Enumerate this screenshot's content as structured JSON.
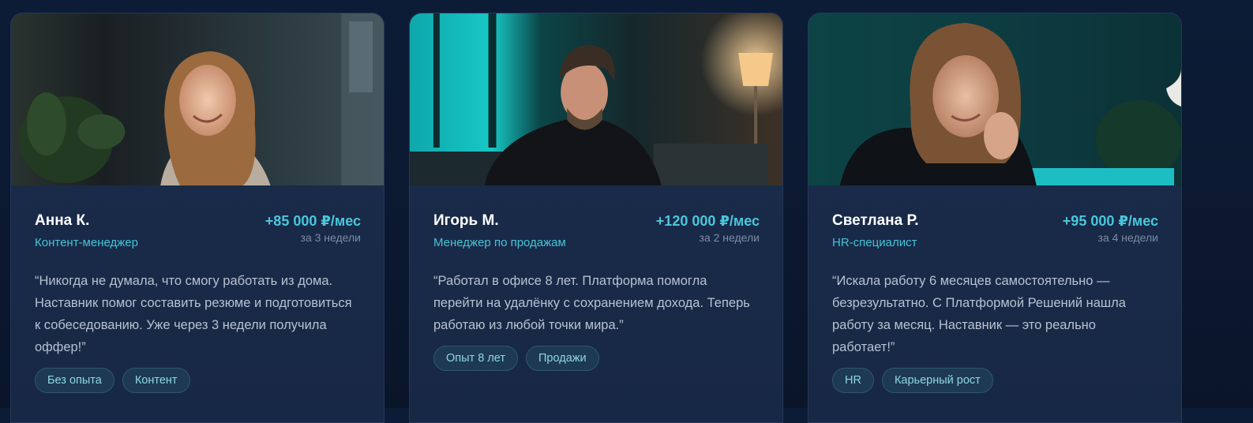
{
  "testimonials": [
    {
      "name": "Анна К.",
      "role": "Контент-менеджер",
      "income": "+85 000 ₽/мес",
      "period": "за 3 недели",
      "quote": "“Никогда не думала, что смогу работать из дома. Наставник помог составить резюме и подготовиться к собеседованию. Уже через 3 недели получила оффер!”",
      "tags": [
        "Без опыта",
        "Контент"
      ]
    },
    {
      "name": "Игорь М.",
      "role": "Менеджер по продажам",
      "income": "+120 000 ₽/мес",
      "period": "за 2 недели",
      "quote": "“Работал в офисе 8 лет. Платформа помогла перейти на удалёнку с сохранением дохода. Теперь работаю из любой точки мира.”",
      "tags": [
        "Опыт 8 лет",
        "Продажи"
      ]
    },
    {
      "name": "Светлана Р.",
      "role": "HR-специалист",
      "income": "+95 000 ₽/мес",
      "period": "за 4 недели",
      "quote": "“Искала работу 6 месяцев самостоятельно — безрезультатно. С Платформой Решений нашла работу за месяц. Наставник — это реально работает!”",
      "tags": [
        "HR",
        "Карьерный рост"
      ]
    }
  ],
  "colors": {
    "accent": "#48c7dc",
    "card_bg": "#1b2d4b",
    "page_bg": "#0b1830"
  }
}
